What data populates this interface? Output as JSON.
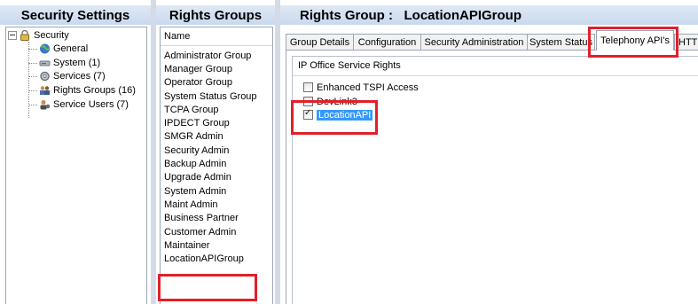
{
  "security_panel": {
    "title": "Security Settings",
    "tree": [
      {
        "label": "Security",
        "icon": "security-lock-icon"
      },
      {
        "label": "General",
        "icon": "globe-icon"
      },
      {
        "label": "System (1)",
        "icon": "system-icon"
      },
      {
        "label": "Services (7)",
        "icon": "services-icon"
      },
      {
        "label": "Rights Groups (16)",
        "icon": "rights-groups-icon"
      },
      {
        "label": "Service Users (7)",
        "icon": "service-users-icon"
      }
    ]
  },
  "rights_panel": {
    "title": "Rights Groups",
    "column_header": "Name",
    "items": [
      "Administrator Group",
      "Manager Group",
      "Operator Group",
      "System Status Group",
      "TCPA Group",
      "IPDECT Group",
      "SMGR Admin",
      "Security Admin",
      "Backup Admin",
      "Upgrade Admin",
      "System Admin",
      "Maint Admin",
      "Business Partner",
      "Customer Admin",
      "Maintainer",
      "LocationAPIGroup"
    ],
    "selected": "LocationAPIGroup"
  },
  "detail_panel": {
    "title": "Rights Group :   LocationAPIGroup",
    "tabs": [
      "Group Details",
      "Configuration",
      "Security Administration",
      "System Status",
      "Telephony API's",
      "HTT"
    ],
    "active_tab": "Telephony API's",
    "group_title": "IP Office Service Rights",
    "rights": [
      {
        "label": "Enhanced TSPI Access",
        "checked": false
      },
      {
        "label": "DevLink3",
        "checked": false
      },
      {
        "label": "LocationAPI",
        "checked": true
      }
    ]
  },
  "colors": {
    "header_gradient": "#c9d9ee",
    "highlight_red": "#e0202a",
    "selection_blue": "#3399ff"
  }
}
